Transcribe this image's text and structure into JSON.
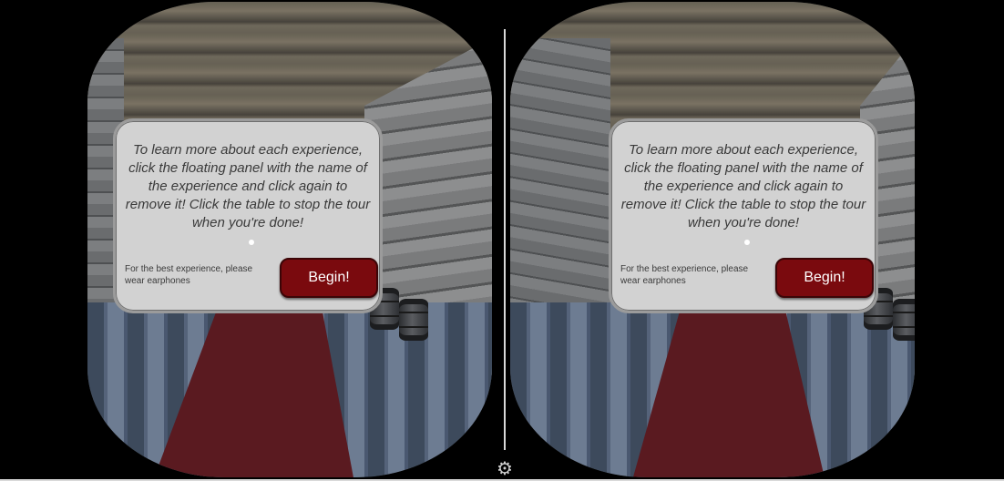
{
  "panel": {
    "message": "To learn more about each experience, click the floating panel with the name of the experience and click again to remove it! Click the table to stop the tour when you're done!",
    "note": "For the best experience, please wear earphones",
    "begin_label": "Begin!"
  },
  "controls": {
    "settings_icon": "gear-icon"
  },
  "colors": {
    "panel_bg": "#d2d2d2",
    "button_bg": "#7a0a0e",
    "carpet": "#5a1a20"
  }
}
